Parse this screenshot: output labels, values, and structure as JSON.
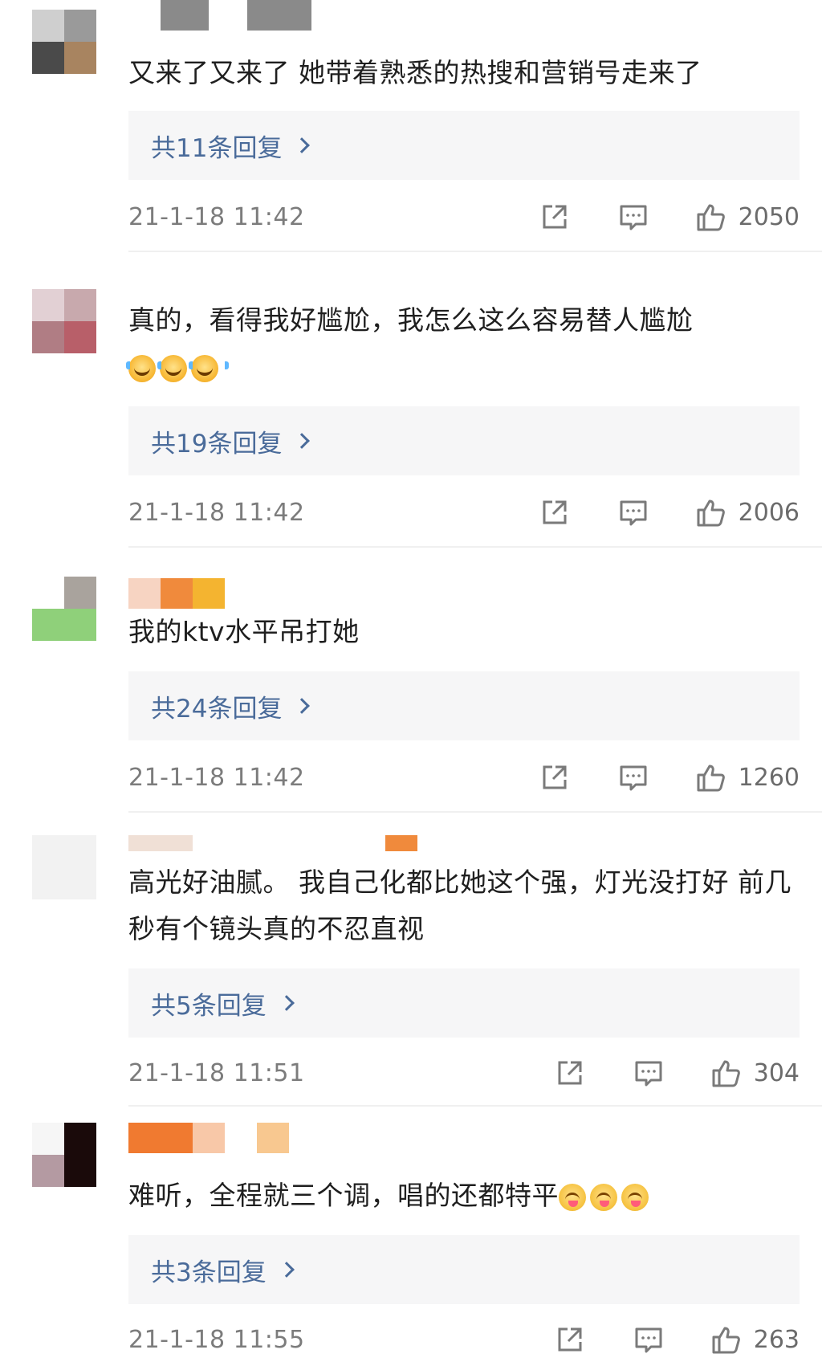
{
  "comments": [
    {
      "text": "又来了又来了 她带着熟悉的热搜和营销号走来了",
      "replies": "共11条回复",
      "time": "21-1-18 11:42",
      "likes": "2050",
      "avatar_colors": [
        "#cfcfcf",
        "#9a9a9a",
        "#4a4a4a",
        "#a88460"
      ],
      "name_colors": [
        "#8a8a8a",
        "#8a8a8a"
      ]
    },
    {
      "text": "真的，看得我好尴尬，我怎么这么容易替人尴尬",
      "emoji": [
        "laugh-cry-emoji",
        "laugh-cry-emoji",
        "laugh-cry-emoji"
      ],
      "replies": "共19条回复",
      "time": "21-1-18 11:42",
      "likes": "2006",
      "avatar_colors": [
        "#e2d0d4",
        "#c8a9ad",
        "#b07d84",
        "#b85f69"
      ]
    },
    {
      "text": "我的ktv水平吊打她",
      "replies": "共24条回复",
      "time": "21-1-18 11:42",
      "likes": "1260",
      "avatar_colors": [
        "#ffffff",
        "#a9a39d",
        "#8fd07a",
        "#8fd07a"
      ],
      "name_colors": [
        "#f7d4c2",
        "#f08a3c",
        "#f4b430"
      ]
    },
    {
      "text": "高光好油腻。 我自己化都比她这个强，灯光没打好 前几秒有个镜头真的不忍直视",
      "replies": "共5条回复",
      "time": "21-1-18 11:51",
      "likes": "304",
      "avatar_colors": [
        "#f2f2f2",
        "#f2f2f2",
        "#f2f2f2",
        "#f2f2f2"
      ],
      "name_colors": [
        "#f0e0d6",
        "#f08a3c"
      ]
    },
    {
      "text": "难听，全程就三个调，唱的还都特平",
      "emoji": [
        "yum-emoji",
        "yum-emoji",
        "yum-emoji"
      ],
      "replies": "共3条回复",
      "time": "21-1-18 11:55",
      "likes": "263",
      "avatar_colors": [
        "#f6f6f6",
        "#1a0a0a",
        "#b49aa2",
        "#1a0a0a"
      ],
      "name_colors": [
        "#f07a30",
        "#f8c8a8",
        "#f8c890"
      ]
    }
  ],
  "icons": {
    "share": "share-icon",
    "comment": "comment-icon",
    "like": "thumbs-up-icon",
    "replies_arrow": "chevron-right-icon"
  },
  "colors": {
    "link": "#4a6b9a",
    "meta_text": "#7c7c7c",
    "reply_bg": "#f6f6f7"
  }
}
